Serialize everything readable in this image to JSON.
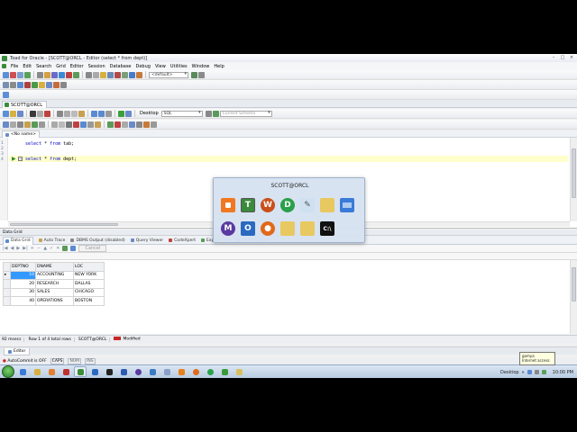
{
  "window": {
    "title": "Toad for Oracle - [SCOTT@ORCL - Editor (select * from dept)]",
    "controls": [
      "–",
      "□",
      "×"
    ]
  },
  "menu": [
    "File",
    "Edit",
    "Search",
    "Grid",
    "Editor",
    "Session",
    "Database",
    "Debug",
    "View",
    "Utilities",
    "Window",
    "Help"
  ],
  "toolbar": {
    "default_combo": "<default>",
    "desktop_label": "Desktop",
    "sql_combo": "SQL",
    "schema_combo": "Current Schema"
  },
  "connection_tab": "SCOTT@ORCL",
  "doc_tab": "<No name>",
  "editor": {
    "line_numbers": [
      "1",
      "2",
      "3",
      "4"
    ],
    "line1": {
      "kw1": "select",
      "rest1": " * ",
      "kw2": "from",
      "rest2": " tab;"
    },
    "line4": {
      "kw1": "select",
      "rest1": " * ",
      "kw2": "from",
      "rest2": " dept;"
    }
  },
  "popup": {
    "title": "SCOTT@ORCL",
    "icons_row1": [
      "orange-square-icon",
      "toad-icon",
      "wordpress-icon",
      "d-app-icon",
      "paint-icon",
      "folder-icon",
      "monitor-icon"
    ],
    "icons_row2": [
      "m-app-icon",
      "outlook-icon",
      "firefox-icon",
      "folder-icon",
      "folder-icon",
      "cmd-icon"
    ]
  },
  "data_grid_title": "Data Grid",
  "result_tabs": [
    "Data Grid",
    "Auto Trace",
    "DBMS Output (disabled)",
    "Query Viewer",
    "CodeXpert",
    "Explain Plan",
    "Script Output"
  ],
  "grid_toolbar": {
    "cancel_label": "Cancel"
  },
  "grid": {
    "columns": [
      "DEPTNO",
      "DNAME",
      "LOC"
    ],
    "rows": [
      [
        "10",
        "ACCOUNTING",
        "NEW YORK"
      ],
      [
        "20",
        "RESEARCH",
        "DALLAS"
      ],
      [
        "30",
        "SALES",
        "CHICAGO"
      ],
      [
        "40",
        "OPERATIONS",
        "BOSTON"
      ]
    ]
  },
  "status": {
    "time": "92 msecs",
    "rows": "Row 1 of 4 total rows",
    "conn": "SCOTT@ORCL",
    "modified": "Modified"
  },
  "editor_tab": "Editor",
  "bottom_status": {
    "autocommit": "AutoCommit is OFF",
    "caps": "CAPS",
    "num": "NUM",
    "ins": "INS"
  },
  "tooltip": {
    "line1": "gamya",
    "line2": "Internet access"
  },
  "taskbar": {
    "desktop": "Desktop",
    "clock": "10:00 PM"
  },
  "colors": {
    "accent": "#3399ff",
    "keyword": "#0000cc",
    "modified": "#c62828"
  }
}
